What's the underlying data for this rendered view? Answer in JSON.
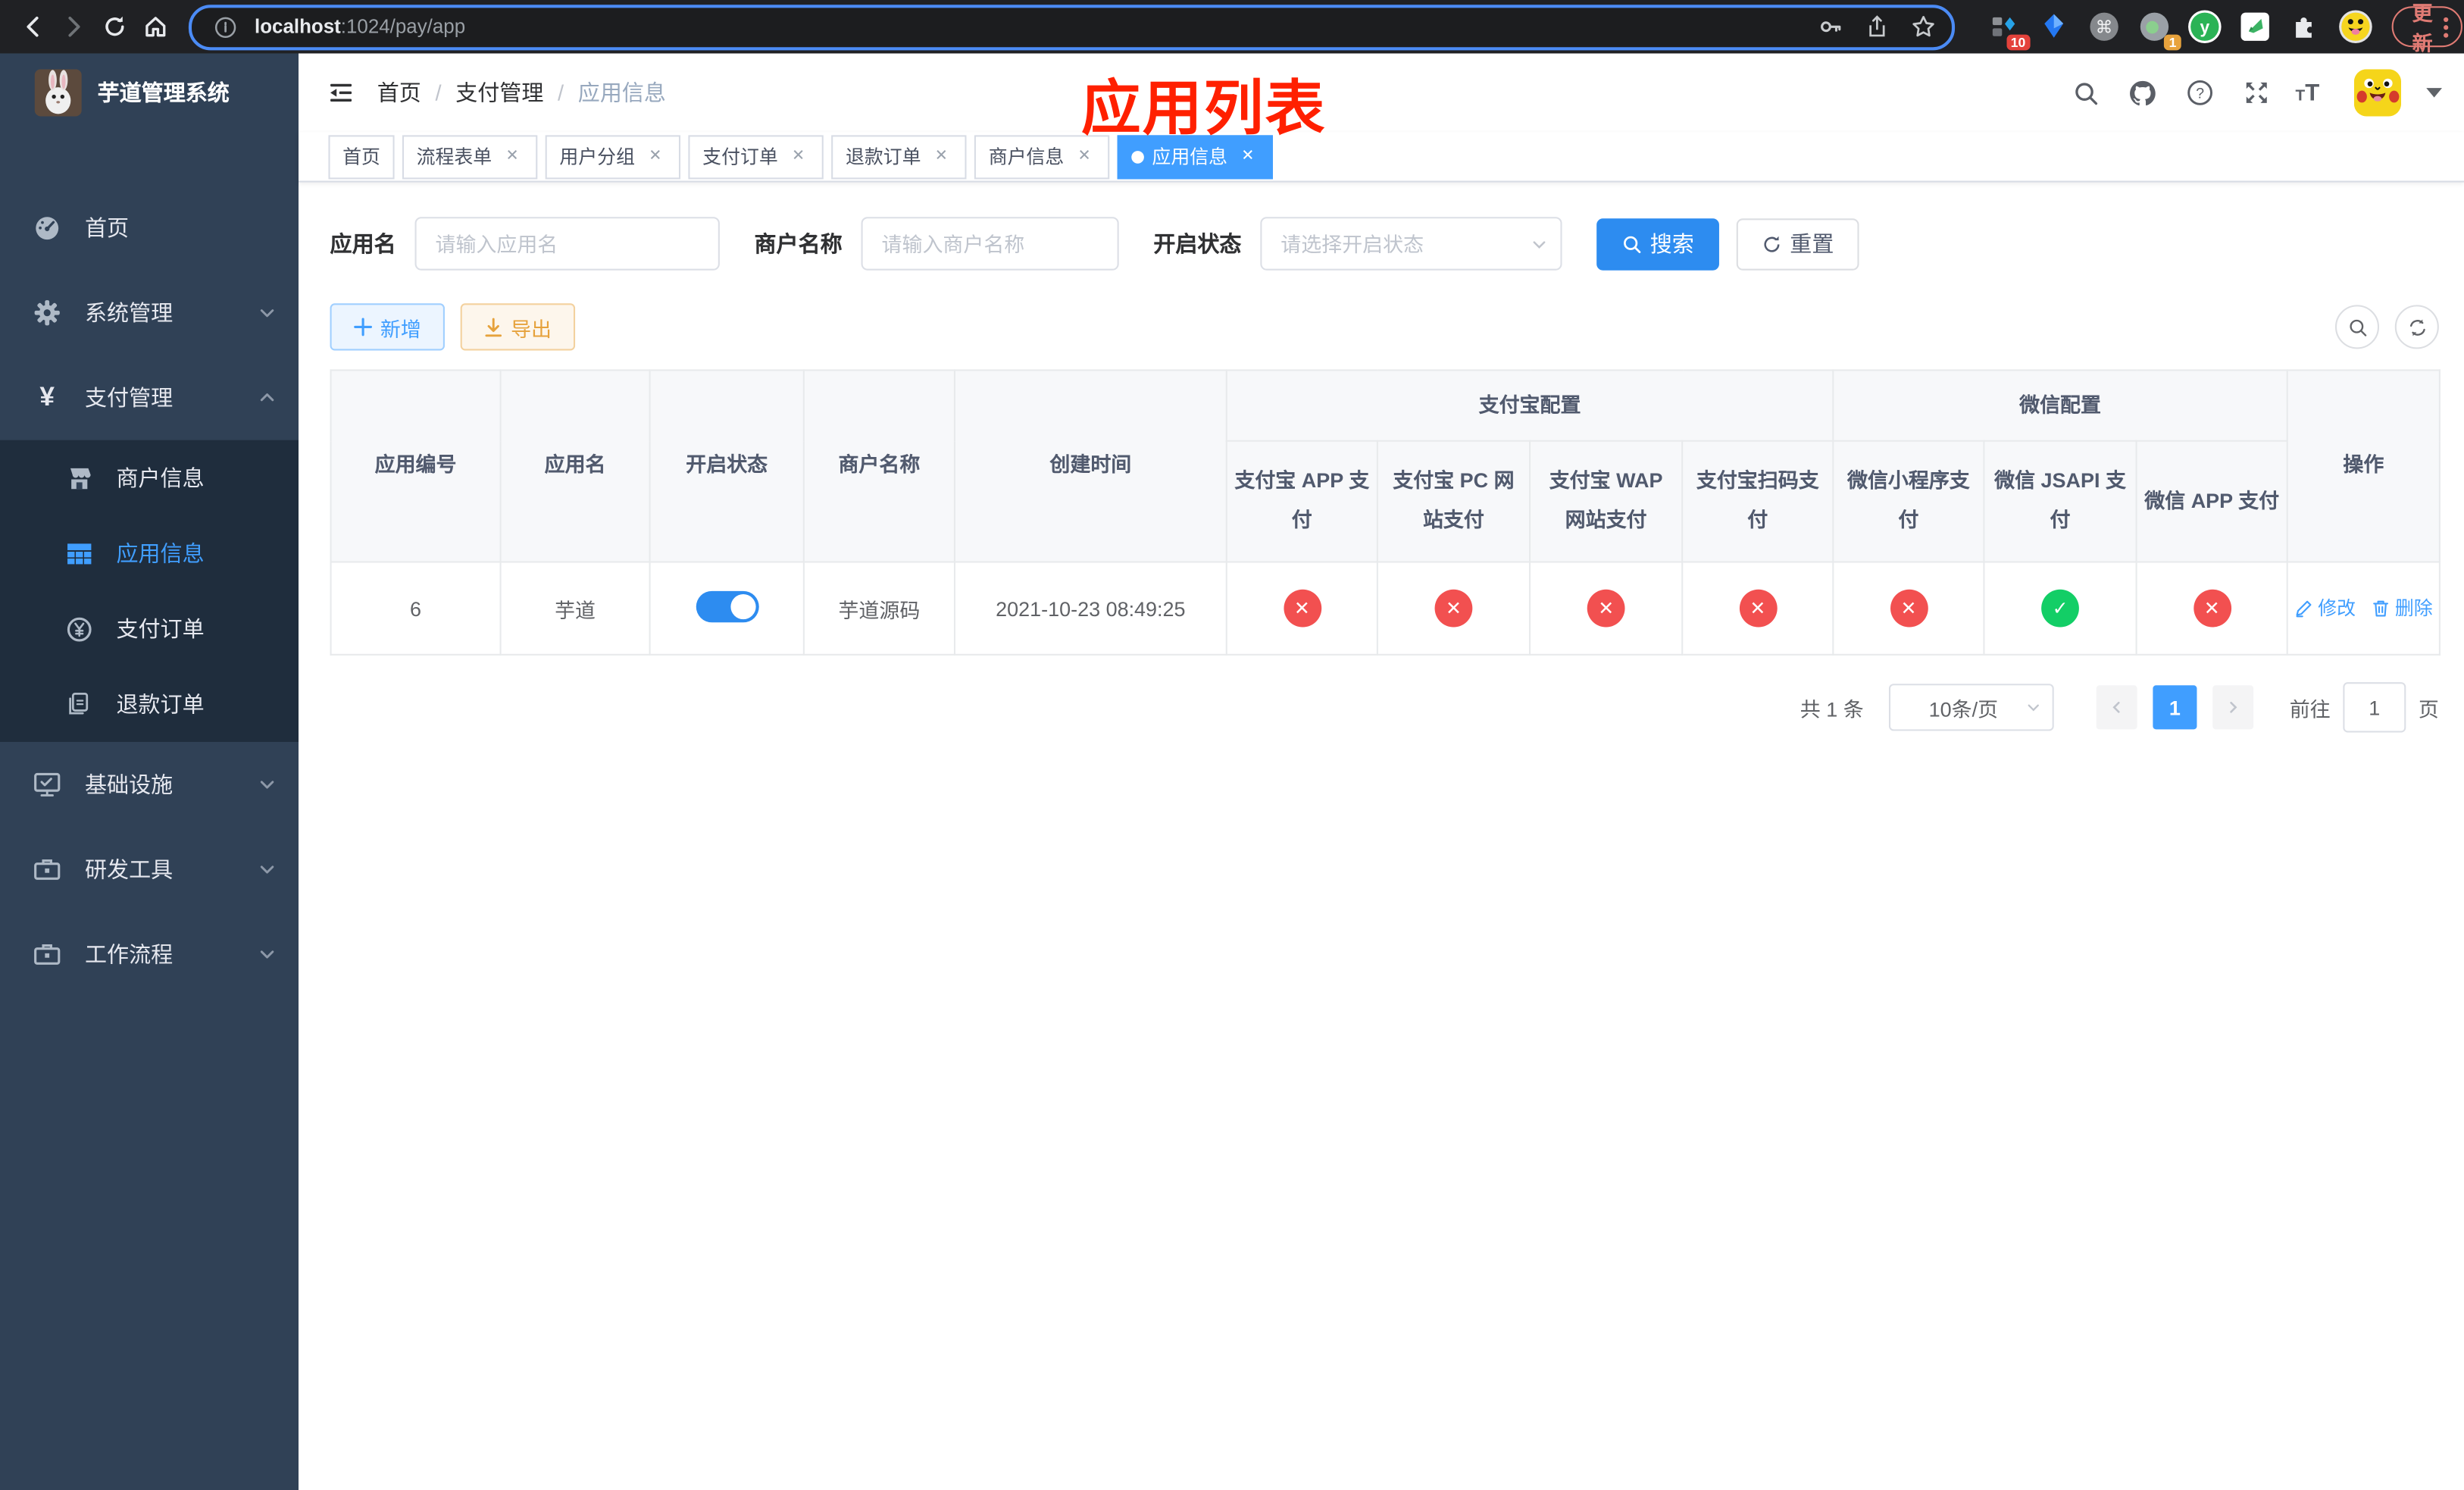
{
  "browser": {
    "url_host": "localhost",
    "url_rest": ":1024/pay/app",
    "update_label": "更新",
    "ext_badge_blue": "10",
    "ext_badge_orange": "1"
  },
  "header": {
    "breadcrumb": [
      "首页",
      "支付管理",
      "应用信息"
    ],
    "annotation": "应用列表"
  },
  "sidebar": {
    "title": "芋道管理系统",
    "items": [
      {
        "label": "首页"
      },
      {
        "label": "系统管理"
      },
      {
        "label": "支付管理"
      },
      {
        "label": "基础设施"
      },
      {
        "label": "研发工具"
      },
      {
        "label": "工作流程"
      }
    ],
    "pay_submenu": [
      {
        "label": "商户信息"
      },
      {
        "label": "应用信息"
      },
      {
        "label": "支付订单"
      },
      {
        "label": "退款订单"
      }
    ]
  },
  "tabs": [
    {
      "label": "首页"
    },
    {
      "label": "流程表单"
    },
    {
      "label": "用户分组"
    },
    {
      "label": "支付订单"
    },
    {
      "label": "退款订单"
    },
    {
      "label": "商户信息"
    },
    {
      "label": "应用信息"
    }
  ],
  "filters": {
    "name_label": "应用名",
    "name_placeholder": "请输入应用名",
    "merchant_label": "商户名称",
    "merchant_placeholder": "请输入商户名称",
    "status_label": "开启状态",
    "status_placeholder": "请选择开启状态",
    "search_label": "搜索",
    "reset_label": "重置"
  },
  "toolbar": {
    "add_label": "新增",
    "export_label": "导出"
  },
  "table": {
    "groups": [
      {
        "label": "支付宝配置"
      },
      {
        "label": "微信配置"
      }
    ],
    "columns": [
      "应用编号",
      "应用名",
      "开启状态",
      "商户名称",
      "创建时间",
      "支付宝 APP 支付",
      "支付宝 PC 网站支付",
      "支付宝 WAP 网站支付",
      "支付宝扫码支付",
      "微信小程序支付",
      "微信 JSAPI 支付",
      "微信 APP 支付",
      "操作"
    ],
    "row": {
      "id": "6",
      "name": "芋道",
      "enabled": true,
      "merchant": "芋道源码",
      "created_at": "2021-10-23 08:49:25",
      "channel_states": [
        0,
        0,
        0,
        0,
        0,
        1,
        0
      ],
      "edit_label": "修改",
      "delete_label": "删除"
    }
  },
  "pagination": {
    "total_label": "共 1 条",
    "page_size_label": "10条/页",
    "current_page": "1",
    "goto_label": "前往",
    "goto_value": "1",
    "page_unit": "页"
  },
  "colors": {
    "accent": "#409eff",
    "danger": "#f25050",
    "success": "#13ce66",
    "warning": "#e6a23c",
    "sidebar_bg": "#304156",
    "submenu_bg": "#1f2d3d",
    "annotation_red": "#ff2000"
  }
}
